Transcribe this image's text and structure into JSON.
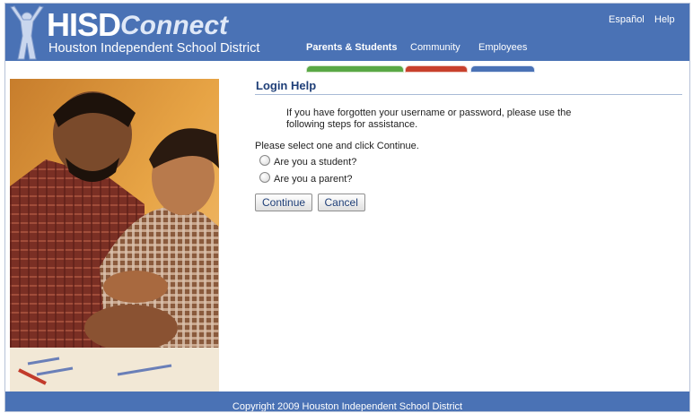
{
  "header": {
    "logo": {
      "brand_bold": "HISD",
      "brand_script": "Connect",
      "subtitle": "Houston Independent School District"
    },
    "utility_links": [
      {
        "label": "Español"
      },
      {
        "label": "Help"
      }
    ],
    "tabs": [
      {
        "label": "Parents & Students",
        "color": "#5aa845"
      },
      {
        "label": "Community",
        "color": "#c8402c"
      },
      {
        "label": "Employees",
        "color": "#4a72b5"
      }
    ]
  },
  "main": {
    "title": "Login Help",
    "intro": "If you have forgotten your username or password, please use the following steps for assistance.",
    "instruction": "Please select one and click Continue.",
    "options": [
      {
        "label": "Are you a student?",
        "selected": false
      },
      {
        "label": "Are you a parent?",
        "selected": false
      }
    ],
    "buttons": {
      "continue": "Continue",
      "cancel": "Cancel"
    }
  },
  "footer": {
    "copyright": "Copyright 2009 Houston Independent School District"
  },
  "colors": {
    "header_bg": "#4a72b5",
    "heading_text": "#1f3f78"
  }
}
